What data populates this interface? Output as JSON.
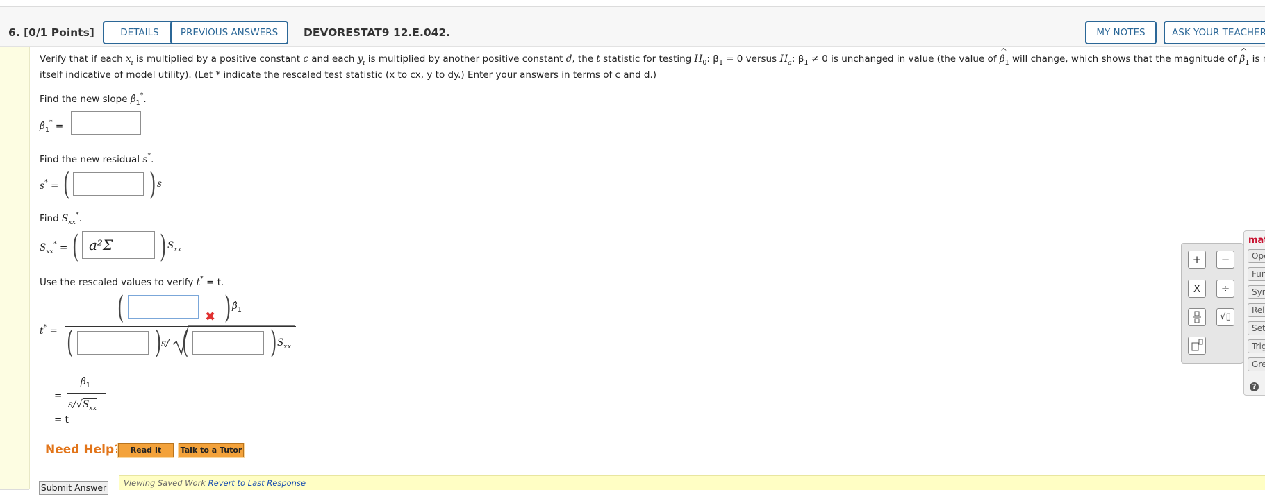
{
  "header": {
    "question_number": "6.",
    "points": "[0/1 Points]",
    "details_label": "DETAILS",
    "previous_answers_label": "PREVIOUS ANSWERS",
    "question_code": "DEVORESTAT9 12.E.042.",
    "my_notes_label": "MY NOTES",
    "ask_teacher_label": "ASK YOUR TEACHER"
  },
  "problem": {
    "intro_1": "Verify that if each ",
    "xi": "x",
    "sub_i": "i",
    "intro_2": " is multiplied by a positive constant ",
    "c": "c",
    "intro_3": " and each ",
    "yi": "y",
    "intro_4": " is multiplied by another positive constant ",
    "d": "d",
    "intro_5": ", the ",
    "t": "t",
    "intro_6": " statistic for testing ",
    "H": "H",
    "sub_0": "0",
    "h0_rest": ": β",
    "sub_1": "1",
    "h0_eq": " = 0 versus ",
    "sub_a": "a",
    "ha_rest": ": β",
    "ha_eq": " ≠ 0 is unchanged in value (the value of ",
    "beta": "β",
    "intro_7": " will change, which shows that the magnitude of ",
    "intro_8": " is not by",
    "line2": "itself indicative of model utility). (Let * indicate the rescaled test statistic (x to cx, y to dy.) Enter your answers in terms of c and d.)"
  },
  "parts": {
    "slope_prompt": "Find the new slope ",
    "slope_prompt_end": ".",
    "residual_prompt": "Find the new residual ",
    "residual_end": ".",
    "sxx_prompt": "Find ",
    "sxx_end": ".",
    "verify_prompt": "Use the rescaled values to verify ",
    "verify_eq": " = t.",
    "beta1_star_label": "β̂",
    "star": "*",
    "equals": "=",
    "s_var": "s",
    "S_var": "S",
    "xx": "xx",
    "sxx_prefill": "a²Σ",
    "t_star": "t",
    "s_slash": "s/",
    "final_beta": "β̂",
    "final_den": "s/",
    "final_eq_t": "= t"
  },
  "help": {
    "need_help": "Need Help?",
    "read_it": "Read It",
    "talk_tutor": "Talk to a Tutor"
  },
  "submit": {
    "submit_label": "Submit Answer",
    "viewing": "Viewing Saved Work ",
    "revert": "Revert to Last Response"
  },
  "palette": {
    "plus": "+",
    "minus": "−",
    "times": "X",
    "divide": "÷",
    "sqrt": "√▯",
    "title": "mat",
    "categories": [
      "Ope",
      "Fun",
      "Sym",
      "Rel",
      "Set",
      "Trig",
      "Gre"
    ],
    "help_mark": "?"
  },
  "colors": {
    "accent_blue": "#2b6797",
    "need_help_orange": "#e2751a",
    "error_red": "#e03030",
    "left_bar_yellow": "#fdfde2",
    "saved_bar_yellow": "#fffec4"
  }
}
